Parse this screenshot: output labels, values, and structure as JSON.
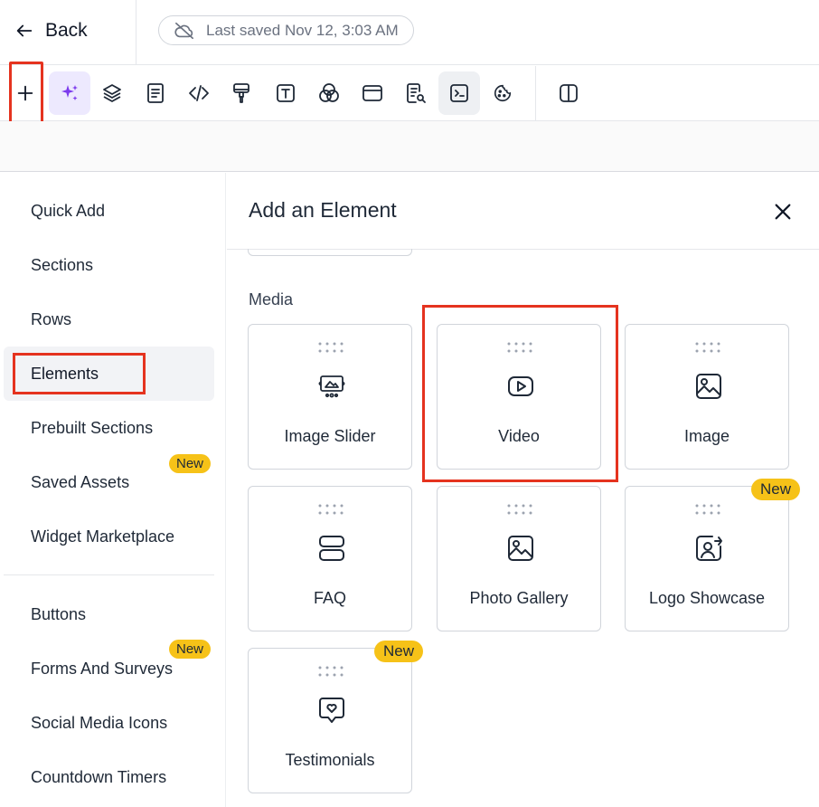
{
  "header": {
    "back_label": "Back",
    "save_status": "Last saved Nov 12, 3:03 AM"
  },
  "toolbar": {
    "tools": [
      "plus-icon",
      "sparkles-icon",
      "layers-icon",
      "document-icon",
      "code-icon",
      "paint-roller-icon",
      "text-icon",
      "color-circles-icon",
      "browser-window-icon",
      "search-document-icon",
      "terminal-icon",
      "cookie-icon",
      "split-view-icon"
    ]
  },
  "sidebar": {
    "items": [
      {
        "label": "Quick Add"
      },
      {
        "label": "Sections"
      },
      {
        "label": "Rows"
      },
      {
        "label": "Elements"
      },
      {
        "label": "Prebuilt Sections"
      },
      {
        "label": "Saved Assets",
        "badge": "New"
      },
      {
        "label": "Widget Marketplace"
      },
      {
        "label": "Buttons"
      },
      {
        "label": "Forms And Surveys",
        "badge": "New"
      },
      {
        "label": "Social Media Icons"
      },
      {
        "label": "Countdown Timers"
      }
    ]
  },
  "panel": {
    "title": "Add an Element",
    "section": "Media",
    "cards": [
      {
        "label": "Image Slider",
        "icon": "image-slider-icon"
      },
      {
        "label": "Video",
        "icon": "video-play-icon"
      },
      {
        "label": "Image",
        "icon": "image-icon"
      },
      {
        "label": "FAQ",
        "icon": "faq-stack-icon"
      },
      {
        "label": "Photo Gallery",
        "icon": "photo-gallery-icon"
      },
      {
        "label": "Logo Showcase",
        "icon": "logo-showcase-icon",
        "badge": "New"
      },
      {
        "label": "Testimonials",
        "icon": "testimonial-chat-icon",
        "badge": "New"
      }
    ]
  },
  "colors": {
    "highlight": "#e5331f",
    "badge": "#f6c218",
    "ai_accent": "#7c3aed"
  }
}
